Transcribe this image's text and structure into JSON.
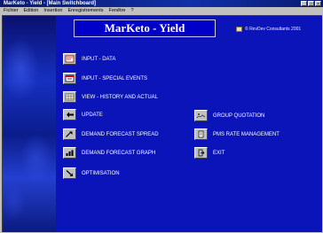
{
  "window": {
    "title": "MarKeto - Yield - [Main Switchboard]",
    "controls": [
      "_",
      "□",
      "×"
    ]
  },
  "menu": [
    "Fichier",
    "Edition",
    "Insertion",
    "Enregistrements",
    "Fenêtre",
    "?"
  ],
  "app": {
    "title": "MarKeto - Yield",
    "copyright": "© RevDev Consultants 2001"
  },
  "buttons": {
    "input_data": "INPUT - DATA",
    "input_special_events": "INPUT - SPECIAL EVENTS",
    "view_history": "VIEW - HISTORY AND ACTUAL",
    "update": "UPDATE",
    "group_quotation": "GROUP QUOTATION",
    "pms_rate_management": "PMS RATE MANAGEMENT",
    "exit": "EXIT",
    "demand_forecast_spread": "DEMAND FORECAST SPREAD",
    "demand_forecast_graph": "DEMAND FORECAST GRAPH",
    "optimisation": "OPTIMISATION"
  },
  "icons": {
    "input_data": "data-entry-icon",
    "input_special_events": "calendar-event-icon",
    "view_history": "table-icon",
    "update": "arrow-left-icon",
    "group_quotation": "group-icon",
    "pms_rate_management": "document-icon",
    "exit": "exit-door-icon",
    "demand_forecast_spread": "trend-arrow-icon",
    "demand_forecast_graph": "bar-graph-icon",
    "optimisation": "diagonal-arrow-icon"
  }
}
